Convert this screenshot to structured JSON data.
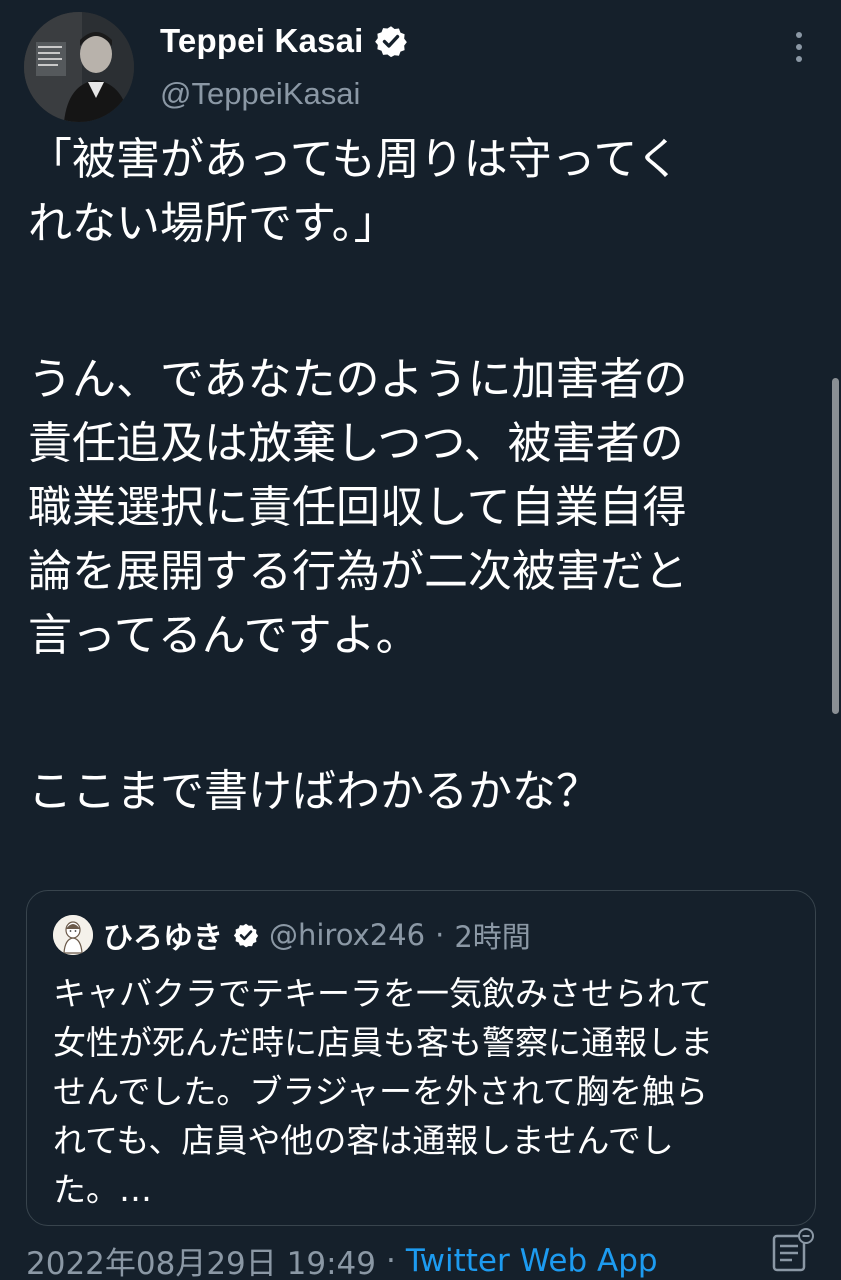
{
  "tweet": {
    "author": {
      "display_name": "Teppei Kasai",
      "handle": "@TeppeiKasai",
      "verified": true
    },
    "text_lines": [
      "「被害があっても周りは守ってく",
      "れない場所です。」",
      "",
      "うん、であなたのように加害者の",
      "責任追及は放棄しつつ、被害者の",
      "職業選択に責任回収して自業自得",
      "論を展開する行為が二次被害だと",
      "言ってるんですよ。",
      "",
      "ここまで書けばわかるかな？"
    ],
    "quoted": {
      "display_name": "ひろゆき",
      "verified": true,
      "handle": "@hirox246",
      "separator": "·",
      "time": "2時間",
      "text_lines": [
        "キャバクラでテキーラを一気飲みさせられて",
        "女性が死んだ時に店員も客も警察に通報しま",
        "せんでした。ブラジャーを外されて胸を触ら",
        "れても、店員や他の客は通報しませんでし",
        "た。…"
      ]
    },
    "timestamp": "2022年08月29日 19:49",
    "separator": "·",
    "source": "Twitter Web App"
  },
  "icons": {
    "verified": "verified-badge-icon",
    "more": "more-vertical-icon",
    "analytics": "analytics-icon"
  },
  "colors": {
    "background": "#15202b",
    "text": "#ffffff",
    "secondary": "#8b98a5",
    "link": "#1d9bf0",
    "border": "#38444d"
  }
}
